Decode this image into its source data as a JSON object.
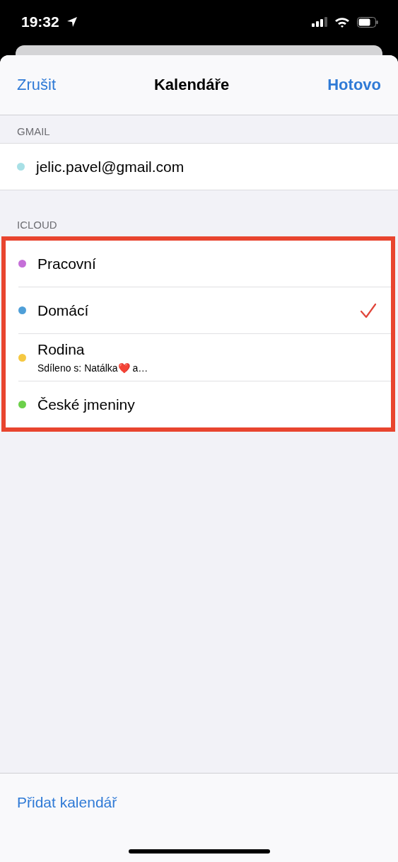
{
  "status_bar": {
    "time": "19:32"
  },
  "nav": {
    "cancel": "Zrušit",
    "title": "Kalendáře",
    "done": "Hotovo"
  },
  "sections": [
    {
      "header": "GMAIL",
      "highlighted": false,
      "calendars": [
        {
          "name": "jelic.pavel@gmail.com",
          "color": "#a8e0e6",
          "checked": false
        }
      ]
    },
    {
      "header": "ICLOUD",
      "highlighted": true,
      "calendars": [
        {
          "name": "Pracovní",
          "color": "#c56fd8",
          "checked": false
        },
        {
          "name": "Domácí",
          "color": "#4f9fd8",
          "checked": true
        },
        {
          "name": "Rodina",
          "subtitle": "Sdíleno s: Natálka❤️ a…",
          "color": "#f5c842",
          "checked": false
        },
        {
          "name": "České jmeniny",
          "color": "#6cd04a",
          "checked": false
        }
      ]
    }
  ],
  "footer": {
    "add_button": "Přidat kalendář"
  }
}
